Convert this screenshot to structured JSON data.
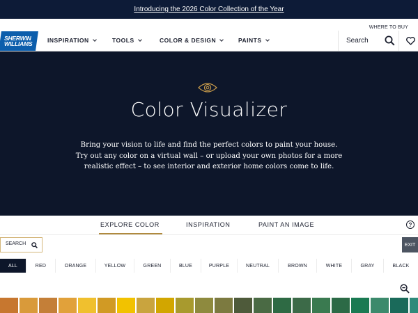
{
  "promo": {
    "text": "Introducing the 2026 Color Collection of the Year"
  },
  "utility": {
    "where_to_buy": "WHERE TO BUY"
  },
  "logo": {
    "line1": "SHERWIN",
    "line2": "WILLIAMS"
  },
  "nav": {
    "items": [
      {
        "label": "INSPIRATION"
      },
      {
        "label": "TOOLS"
      },
      {
        "label": "COLOR & DESIGN"
      },
      {
        "label": "PAINTS"
      }
    ],
    "search_label": "Search"
  },
  "hero": {
    "title": "Color Visualizer",
    "description": "Bring your vision to life and find the perfect colors to paint your house. Try out any color on a virtual wall – or upload your own photos for a more realistic effect – to see interior and exterior home colors come to life."
  },
  "tabs": [
    {
      "label": "EXPLORE COLOR",
      "active": true
    },
    {
      "label": "INSPIRATION",
      "active": false
    },
    {
      "label": "PAINT AN IMAGE",
      "active": false
    }
  ],
  "help_label": "?",
  "search": {
    "placeholder": "SEARCH"
  },
  "exit_label": "EXIT",
  "color_families": [
    {
      "label": "ALL",
      "active": true
    },
    {
      "label": "RED"
    },
    {
      "label": "ORANGE"
    },
    {
      "label": "YELLOW"
    },
    {
      "label": "GREEN"
    },
    {
      "label": "BLUE"
    },
    {
      "label": "PURPLE"
    },
    {
      "label": "NEUTRAL"
    },
    {
      "label": "BROWN"
    },
    {
      "label": "WHITE"
    },
    {
      "label": "GRAY"
    },
    {
      "label": "BLACK"
    }
  ],
  "swatch_colors": [
    "#c7772f",
    "#d99a3a",
    "#c47f38",
    "#e1a13a",
    "#f0c02e",
    "#d19a24",
    "#f2c200",
    "#c9a43e",
    "#d2a600",
    "#a89a2e",
    "#8e8a3e",
    "#7c7a40",
    "#4e5a3a",
    "#4a6a44",
    "#2e6a44",
    "#3c6a48",
    "#3a7a50",
    "#2c6a46",
    "#1a7a52",
    "#3c8a6c",
    "#1a6a5a",
    "#2e8a7a"
  ],
  "colors": {
    "promo_bg": "#0d1b37",
    "hero_bg": "#0d162a",
    "logo_bg": "#0c5eac",
    "accent_gold": "#b08a3e",
    "exit_bg": "#4c5461"
  }
}
